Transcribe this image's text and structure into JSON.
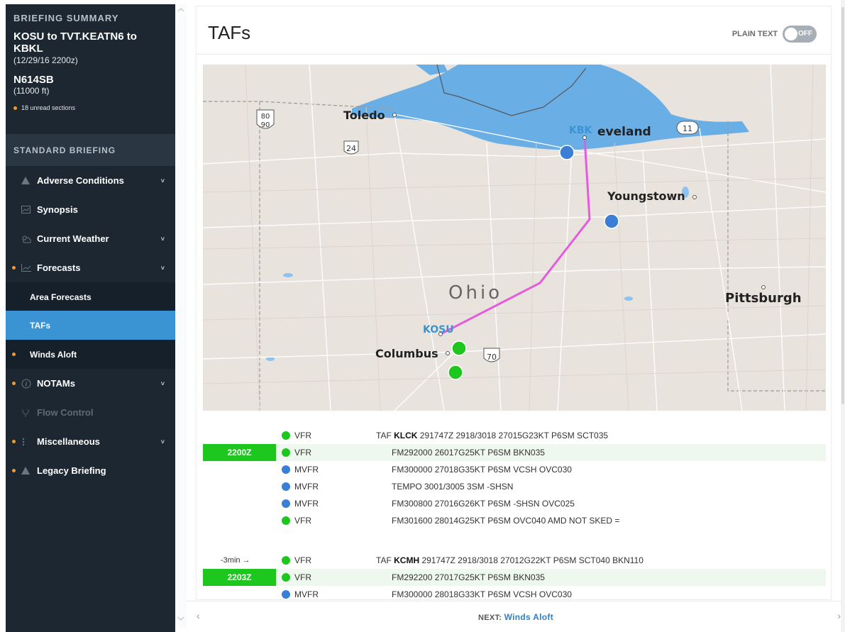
{
  "sidebar": {
    "summary_label": "BRIEFING SUMMARY",
    "route": "KOSU to TVT.KEATN6 to KBKL",
    "route_time": "(12/29/16 2200z)",
    "aircraft": "N614SB",
    "altitude": "(11000 ft)",
    "unread": "18 unread sections",
    "standard_label": "STANDARD BRIEFING",
    "items": [
      {
        "label": "Adverse Conditions",
        "icon": "warning-icon"
      },
      {
        "label": "Synopsis",
        "icon": "chart-icon"
      },
      {
        "label": "Current Weather",
        "icon": "weather-icon"
      },
      {
        "label": "Forecasts",
        "icon": "trend-icon"
      },
      {
        "label": "Area Forecasts"
      },
      {
        "label": "TAFs"
      },
      {
        "label": "Winds Aloft"
      },
      {
        "label": "NOTAMs",
        "icon": "info-icon"
      },
      {
        "label": "Flow Control",
        "icon": "flow-icon"
      },
      {
        "label": "Miscellaneous",
        "icon": "more-icon"
      },
      {
        "label": "Legacy Briefing",
        "icon": "warning-icon"
      }
    ]
  },
  "main": {
    "title": "TAFs",
    "plain_text_label": "PLAIN TEXT",
    "toggle_state": "OFF"
  },
  "map": {
    "labels": {
      "toledo": "Toledo",
      "cleveland_prefix": "KBK",
      "cleveland": "Cleveland",
      "youngstown": "Youngstown",
      "ohio": "Ohio",
      "pittsburgh": "Pittsburgh",
      "kosu": "KOSU",
      "columbus": "Columbus",
      "shield_80": "80",
      "shield_90": "90",
      "shield_24": "24",
      "shield_11": "11",
      "shield_70": "70"
    },
    "colors": {
      "water": "#6aaee6",
      "land": "#e8e2dc",
      "route": "#e65bdc",
      "vfr": "#1ec71e",
      "mvfr": "#3a7ed6"
    }
  },
  "tafs": [
    {
      "station": "KLCK",
      "time_badge": "2200Z",
      "rel_time": "",
      "lines": [
        {
          "cat": "VFR",
          "prefix": "TAF ",
          "text": "291747Z 2918/3018 27015G23KT P6SM SCT035"
        },
        {
          "cat": "VFR",
          "text": "FM292000 26017G25KT P6SM BKN035"
        },
        {
          "cat": "MVFR",
          "text": "FM300000 27018G35KT P6SM VCSH OVC030"
        },
        {
          "cat": "MVFR",
          "text": "TEMPO 3001/3005 3SM -SHSN"
        },
        {
          "cat": "MVFR",
          "text": "FM300800 27016G26KT P6SM -SHSN OVC025"
        },
        {
          "cat": "VFR",
          "text": "FM301600 28014G25KT P6SM OVC040 AMD NOT SKED ="
        }
      ]
    },
    {
      "station": "KCMH",
      "time_badge": "2203Z",
      "rel_time": "-3min →",
      "lines": [
        {
          "cat": "VFR",
          "prefix": "TAF ",
          "text": "291747Z 2918/3018 27012G22KT P6SM SCT040 BKN110"
        },
        {
          "cat": "VFR",
          "text": "FM292200 27017G25KT P6SM BKN035"
        },
        {
          "cat": "MVFR",
          "text": "FM300000 28018G33KT P6SM VCSH OVC030"
        }
      ]
    }
  ],
  "footer": {
    "next_label": "NEXT:",
    "next_target": "Winds Aloft"
  }
}
